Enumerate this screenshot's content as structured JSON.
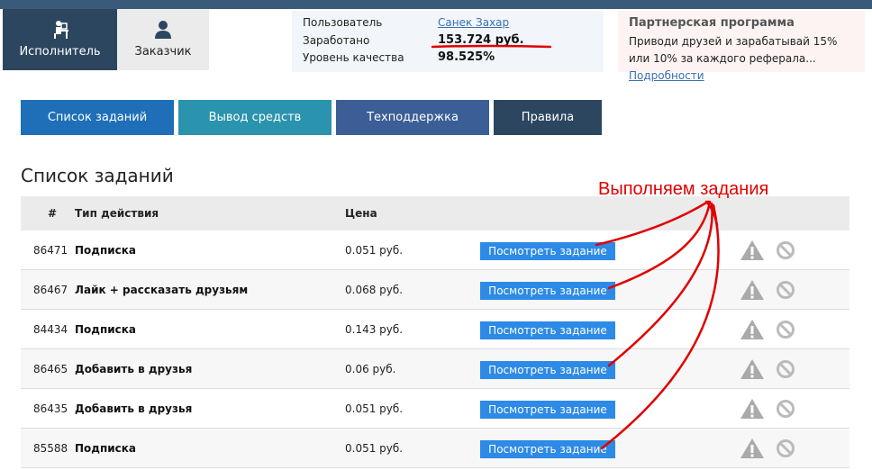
{
  "roles": [
    {
      "label": "Исполнитель",
      "active": true
    },
    {
      "label": "Заказчик",
      "active": false
    }
  ],
  "user": {
    "user_label": "Пользователь",
    "user_value": "Санек Захар",
    "earned_label": "Заработано",
    "earned_value": "153.724 руб.",
    "quality_label": "Уровень качества",
    "quality_value": "98.525%"
  },
  "partner": {
    "title": "Партнерская программа",
    "text": "Приводи друзей и зарабатывай 15% или 10% за каждого реферала...",
    "link": "Подробности"
  },
  "nav": [
    {
      "label": "Список заданий",
      "color": "#1e6fb8"
    },
    {
      "label": "Вывод средств",
      "color": "#2a93ad"
    },
    {
      "label": "Техподдержка",
      "color": "#3b5e96"
    },
    {
      "label": "Правила",
      "color": "#2c4660"
    }
  ],
  "section_title": "Список заданий",
  "table": {
    "headers": [
      "#",
      "Тип действия",
      "Цена"
    ],
    "rows": [
      {
        "id": "86471",
        "type": "Подписка",
        "price": "0.051 руб.",
        "action": "Посмотреть задание"
      },
      {
        "id": "86467",
        "type": "Лайк + рассказать друзьям",
        "price": "0.068 руб.",
        "action": "Посмотреть задание"
      },
      {
        "id": "84434",
        "type": "Подписка",
        "price": "0.143 руб.",
        "action": "Посмотреть задание"
      },
      {
        "id": "86465",
        "type": "Добавить в друзья",
        "price": "0.06 руб.",
        "action": "Посмотреть задание"
      },
      {
        "id": "86435",
        "type": "Добавить в друзья",
        "price": "0.051 руб.",
        "action": "Посмотреть задание"
      },
      {
        "id": "85588",
        "type": "Подписка",
        "price": "0.051 руб.",
        "action": "Посмотреть задание"
      }
    ]
  },
  "annotation": {
    "text": "Выполняем задания",
    "color": "#e00000"
  },
  "icons": {
    "performer": "person-at-desk-icon",
    "customer": "person-icon",
    "warn": "warning-triangle-icon",
    "block": "block-circle-icon"
  },
  "colors": {
    "accent": "#2d8ae6",
    "dark": "#2c4660",
    "header_bar": "#3a5a7a"
  }
}
